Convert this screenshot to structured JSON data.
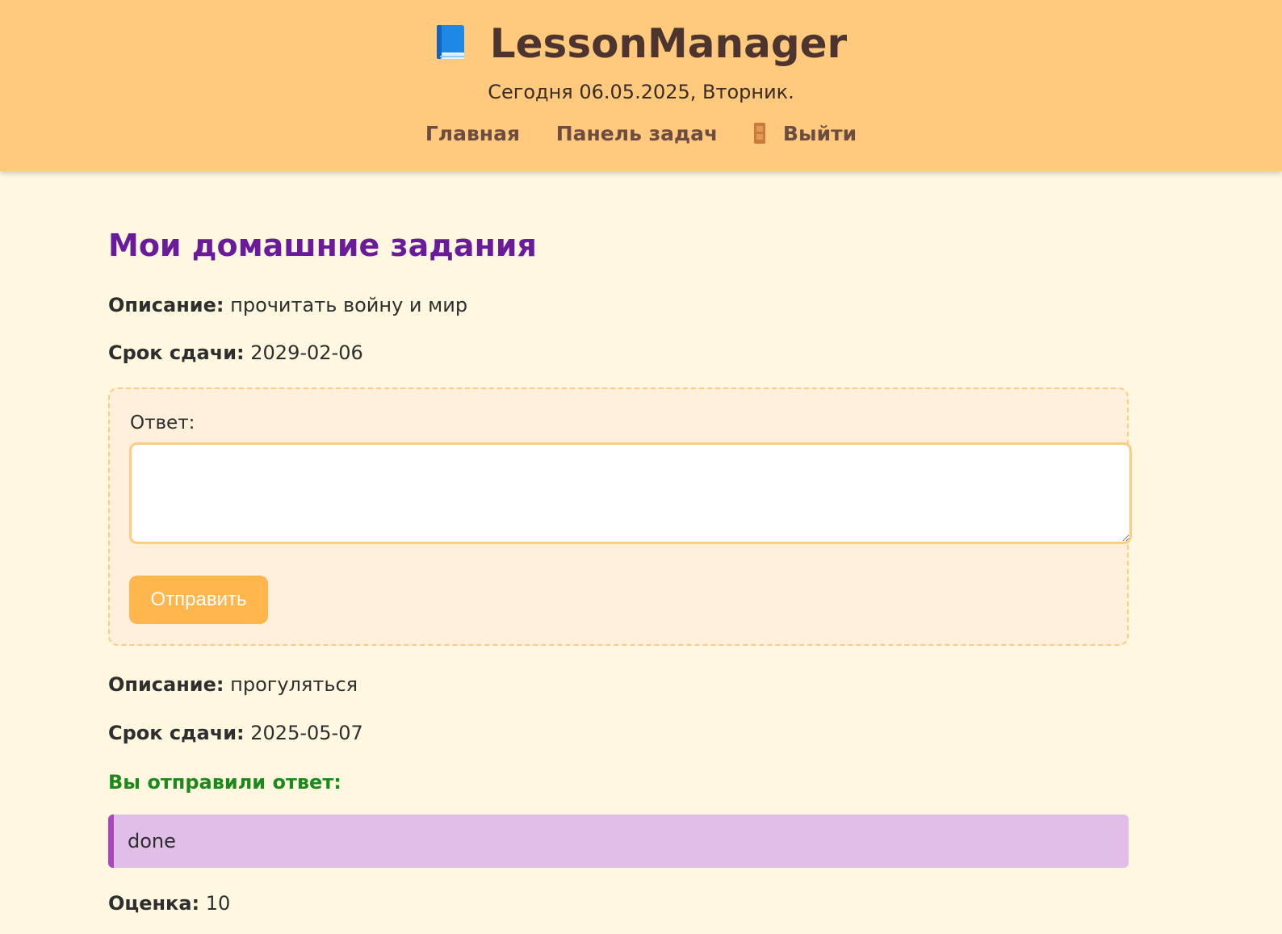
{
  "header": {
    "app_title": "LessonManager",
    "date_text": "Сегодня 06.05.2025, Вторник.",
    "nav": {
      "home": "Главная",
      "tasks": "Панель задач",
      "logout": "Выйти"
    }
  },
  "main": {
    "page_title": "Мои домашние задания",
    "assignments": [
      {
        "description_label": "Описание:",
        "description": "прочитать войну и мир",
        "deadline_label": "Срок сдачи:",
        "deadline": "2029-02-06",
        "answer_label": "Ответ:",
        "answer_value": "",
        "submit_label": "Отправить"
      },
      {
        "description_label": "Описание:",
        "description": "прогуляться",
        "deadline_label": "Срок сдачи:",
        "deadline": "2025-05-07",
        "sent_label": "Вы отправили ответ:",
        "sent_answer": "done",
        "grade_label": "Оценка:",
        "grade": "10"
      }
    ]
  },
  "icons": {
    "brand": "book-icon",
    "logout": "door-icon"
  },
  "colors": {
    "header_bg": "#ffca7d",
    "page_bg": "#fff7df",
    "title_purple": "#6a1b9a",
    "nav_brown": "#6d4c41",
    "button_orange": "#ffb74d",
    "success_green": "#1b8a1b",
    "answer_bg": "#e1bee7",
    "answer_border": "#ab47bc"
  }
}
